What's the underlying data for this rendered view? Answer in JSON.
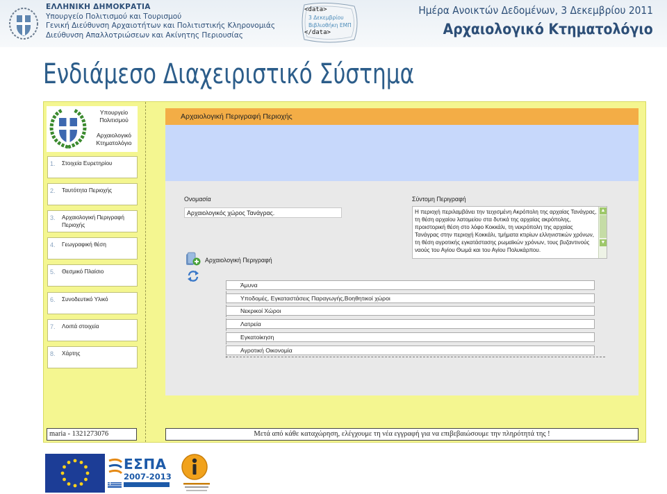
{
  "header": {
    "republic": "ΕΛΛΗΝΙΚΗ ΔΗΜΟΚΡΑΤΙΑ",
    "ministry": "Υπουργείο Πολιτισμού και Τουρισμού",
    "directorate_general": "Γενική Διεύθυνση Αρχαιοτήτων και Πολιτιστικής Κληρονομιάς",
    "directorate": "Διεύθυνση Απαλλοτριώσεων και Ακίνητης Περιουσίας",
    "data_logo": {
      "open_tag": "<data>",
      "line1": "3 Δεκεμβρίου",
      "line2": "Βιβλιοθήκη ΕΜΠ",
      "close_tag": "</data>"
    },
    "event": "Ημέρα Ανοικτών Δεδομένων, 3 Δεκεμβρίου 2011",
    "event_title": "Αρχαιολογικό Κτηματολόγιο"
  },
  "slide_title": "Ενδιάμεσο Διαχειριστικό Σύστημα",
  "app": {
    "logo": {
      "line1": "Υπουργείο",
      "line2": "Πολιτισμού",
      "line3": "Αρχαιολογικό",
      "line4": "Κτηματολόγιο"
    },
    "nav": [
      {
        "num": "1.",
        "label": "Στοιχεία Ευρετηρίου"
      },
      {
        "num": "2.",
        "label": "Ταυτότητα Περιοχής"
      },
      {
        "num": "3.",
        "label": "Αρχαιολογική Περιγραφή Περιοχής"
      },
      {
        "num": "4.",
        "label": "Γεωγραφική θέση"
      },
      {
        "num": "5.",
        "label": "Θεσμικό Πλαίσιο"
      },
      {
        "num": "6.",
        "label": "Συνοδευτικό Υλικό"
      },
      {
        "num": "7.",
        "label": "Λοιπά στοιχεία"
      },
      {
        "num": "8.",
        "label": "Χάρτης"
      }
    ],
    "panel_title": "Αρχαιολογική Περιγραφή Περιοχής",
    "name_label": "Ονομασία",
    "name_value": "Αρχαιολογικός χώρος Τανάγρας.",
    "summary_label": "Σύντομη Περιγραφή",
    "summary_value": "Η περιοχή περιλαμβάνει την τειχισμένη Ακρόπολη της αρχαίας Τανάγρας, τη θέση αρχαίου λατομείου στα δυτικά της αρχαίας ακρόπολης, προιστορική θέση στο λόφο Κοκκάλι, τη νεκρόπολη της αρχαίας Τανάγρας στην περιοχή Κοκκάλι, τμήματα κτιρίων ελληνιστικών χρόνων, τη θέση αγροτικής εγκατάστασης ρωμαϊκών χρόνων, τους βυζαντινούς ναούς του Αγίου Θωμά και του Αγίου Πολυκάρπου.",
    "desc_section_title": "Αρχαιολογική Περιγραφή",
    "categories": [
      "Άμυνα",
      "Υποδομές, Εγκαταστάσεις Παραγωγής,Βοηθητικοί χώροι",
      "Νεκρικοί Χώροι",
      "Λατρεία",
      "Εγκατοίκηση",
      "Αγροτική Οικονομία"
    ],
    "status_user": "maria - 1321273076",
    "status_message": "Μετά από κάθε καταχώρηση, ελέγχουμε τη νέα εγγραφή για να επιβεβαιώσουμε την πληρότητά της !"
  },
  "footer": {
    "espa_name": "ΕΣΠΑ",
    "espa_years": "2007-2013"
  },
  "colors": {
    "accent_blue": "#2c5d8a",
    "app_background": "#f4f690",
    "panel_header": "#f3ad46",
    "panel_band": "#c7d8fb"
  }
}
